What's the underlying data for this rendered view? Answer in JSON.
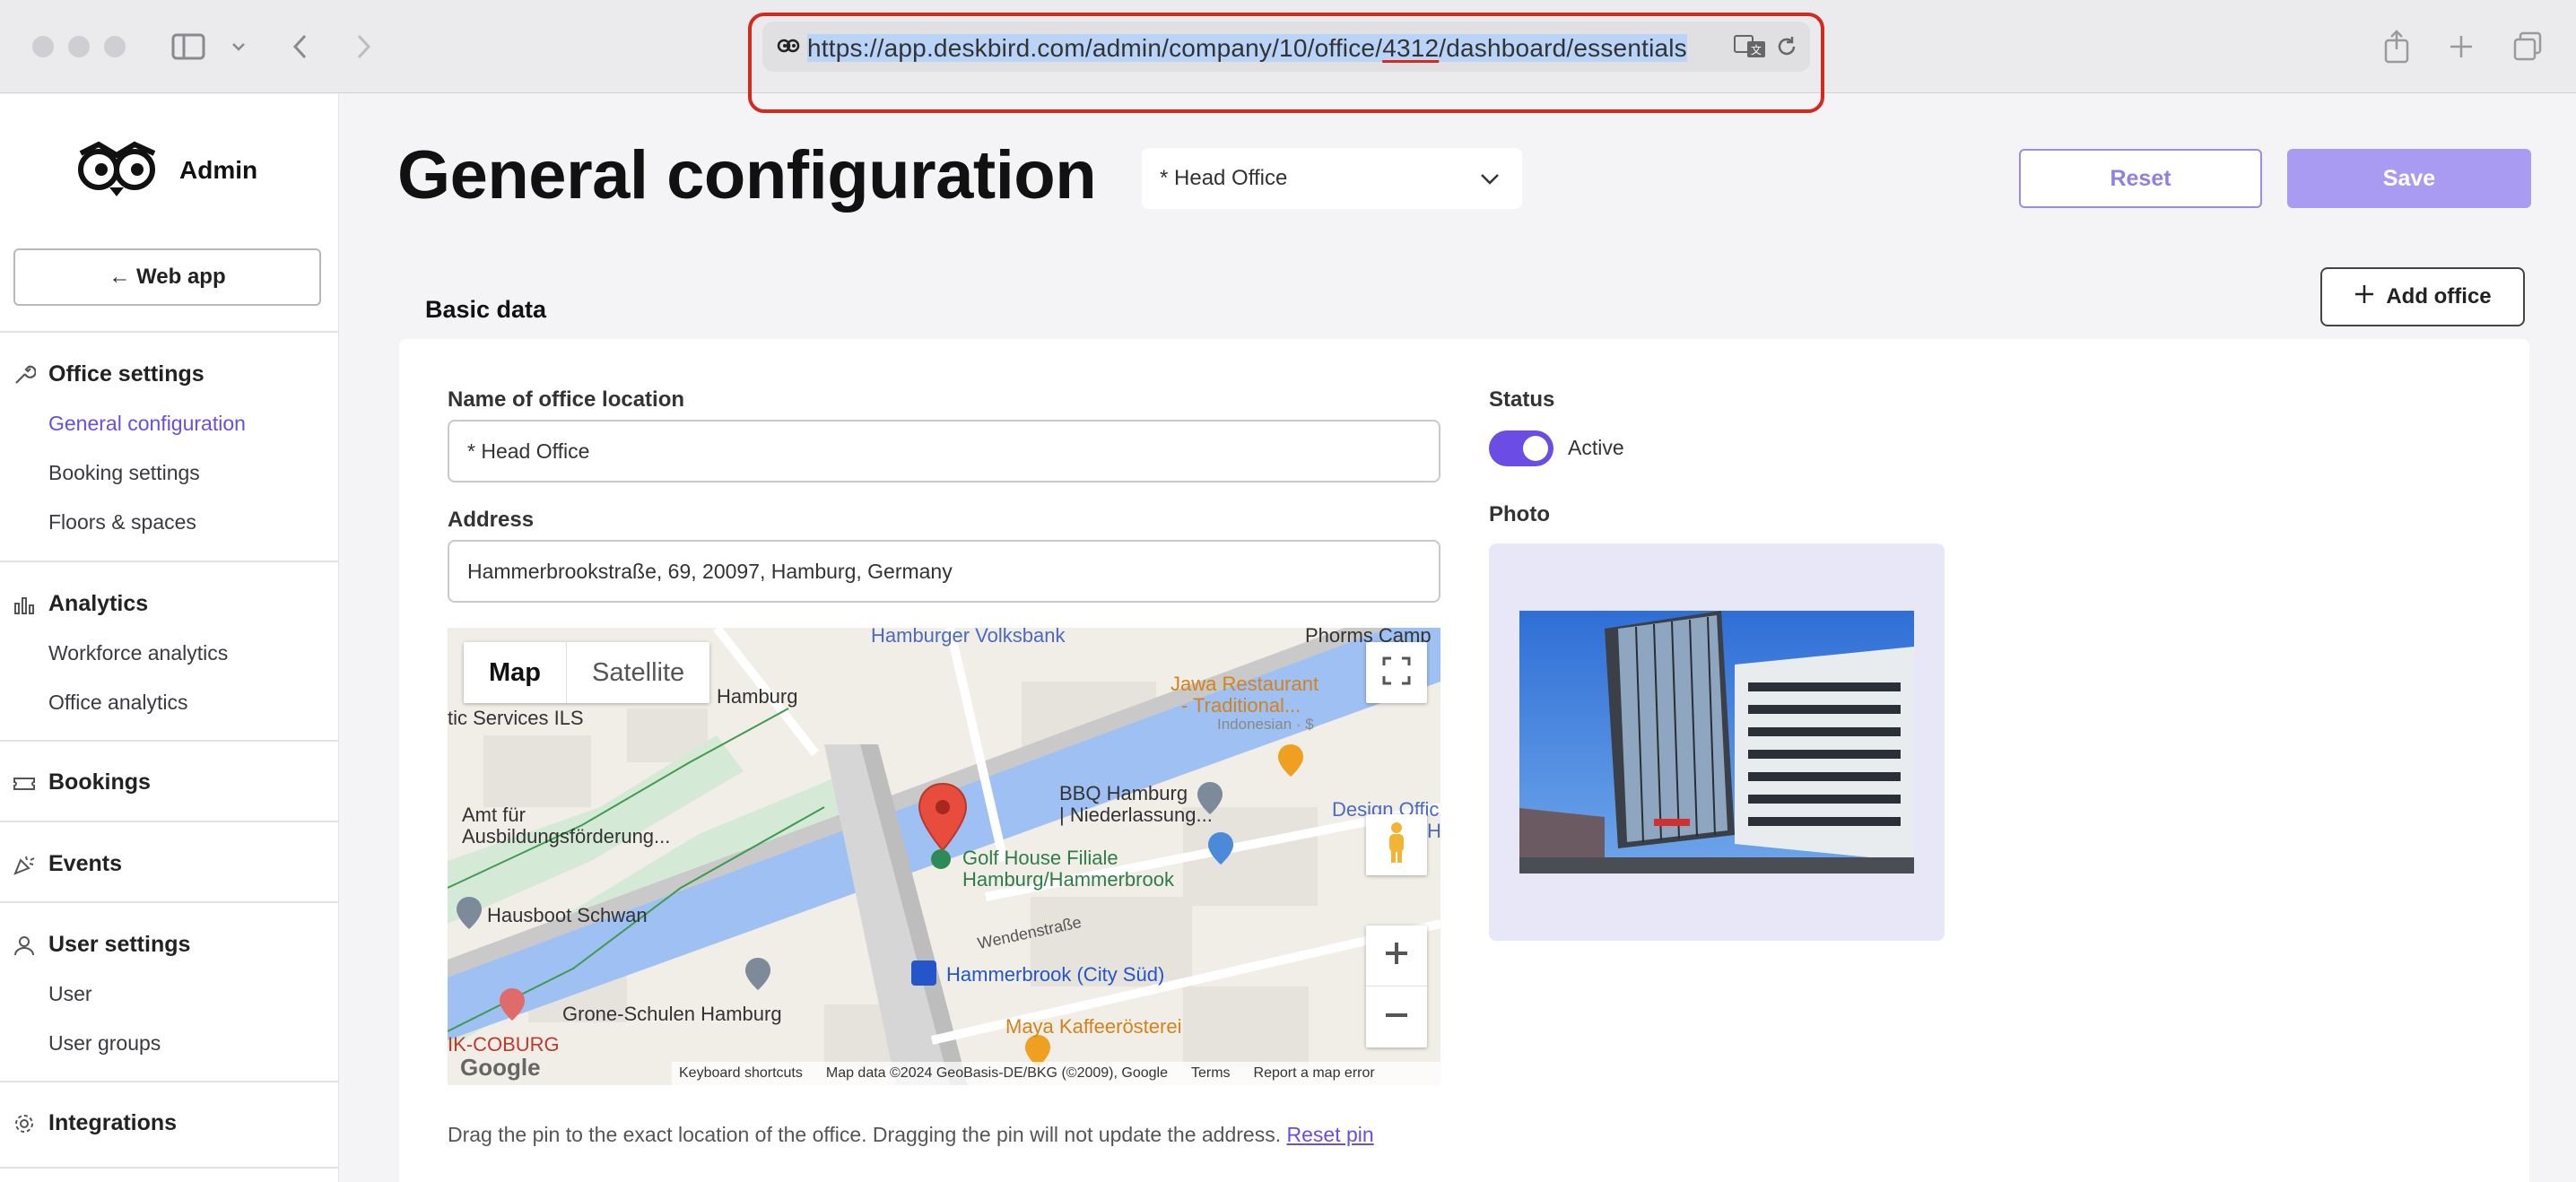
{
  "browser": {
    "url_prefix": "https://app.deskbird.com/admin/company/10/office/",
    "url_highlight": "4312",
    "url_suffix": "/dashboard/essentials"
  },
  "sidebar": {
    "logo_text": "Admin",
    "web_app_label": "← Web app",
    "sections": [
      {
        "title": "Office settings",
        "icon": "wrench-icon",
        "items": [
          "General configuration",
          "Booking settings",
          "Floors & spaces"
        ]
      },
      {
        "title": "Analytics",
        "icon": "bar-chart-icon",
        "items": [
          "Workforce analytics",
          "Office analytics"
        ]
      },
      {
        "title": "Bookings",
        "icon": "ticket-icon",
        "items": []
      },
      {
        "title": "Events",
        "icon": "party-icon",
        "items": []
      },
      {
        "title": "User settings",
        "icon": "user-icon",
        "items": [
          "User",
          "User groups"
        ]
      },
      {
        "title": "Integrations",
        "icon": "cog-icon",
        "items": []
      }
    ],
    "active_item": "General configuration"
  },
  "header": {
    "title": "General configuration",
    "office_select_value": "* Head Office",
    "reset_label": "Reset",
    "save_label": "Save"
  },
  "basic_data": {
    "section_title": "Basic data",
    "add_office_label": "Add office",
    "name_label": "Name of office location",
    "name_value": "* Head Office",
    "address_label": "Address",
    "address_value": "Hammerbrookstraße, 69, 20097, Hamburg, Germany",
    "status_label": "Status",
    "status_value": "Active",
    "photo_label": "Photo"
  },
  "map": {
    "tab_map": "Map",
    "tab_satellite": "Satellite",
    "labels": {
      "volksbank": "Hamburger Volksbank",
      "phorms": "Phorms Camp",
      "hamburg": "Hamburg",
      "services": "tic Services ILS",
      "jawa1": "Jawa Restaurant",
      "jawa2": "- Traditional...",
      "jawa3": "Indonesian · $",
      "bbq1": "BBQ Hamburg",
      "bbq2": "| Niederlassung...",
      "design1": "Design Offic",
      "design2": "H",
      "amt1": "Amt für",
      "amt2": "Ausbildungsförderung...",
      "golf1": "Golf House Filiale",
      "golf2": "Hamburg/Hammerbrook",
      "hausboot": "Hausboot Schwan",
      "wenden": "Wendenstraße",
      "station": "Hammerbrook (City Süd)",
      "grone": "Grone-Schulen Hamburg",
      "coburg": "IK-COBURG",
      "maya": "Maya Kaffeerösterei"
    },
    "footer": {
      "shortcuts": "Keyboard shortcuts",
      "mapdata": "Map data ©2024 GeoBasis-DE/BKG (©2009), Google",
      "terms": "Terms",
      "report": "Report a map error"
    },
    "google": "Google"
  },
  "help": {
    "text": "Drag the pin to the exact location of the office. Dragging the pin will not update the address.",
    "link": "Reset pin"
  }
}
